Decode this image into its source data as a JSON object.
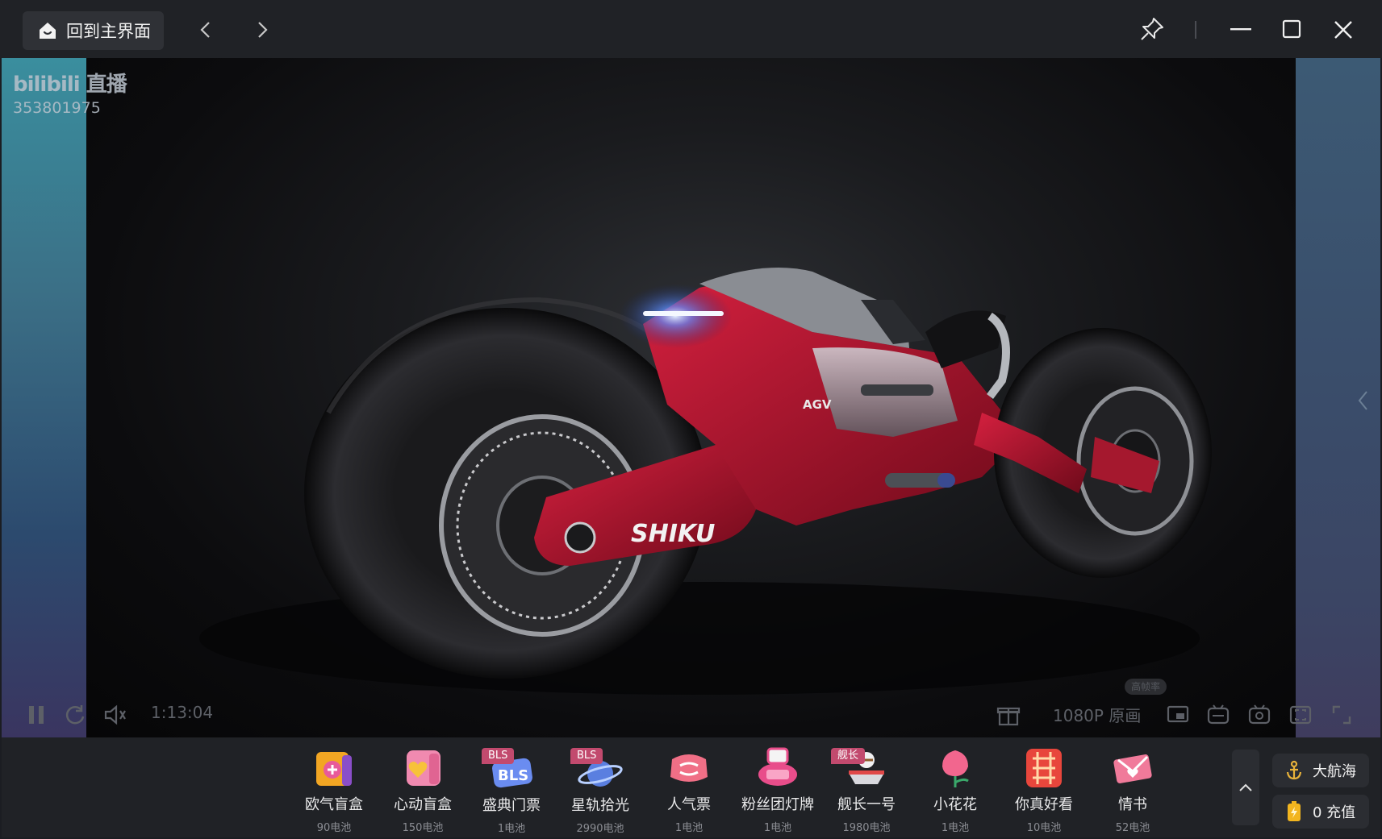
{
  "titlebar": {
    "home_label": "回到主界面",
    "icons": [
      "home-icon",
      "back-icon",
      "forward-icon",
      "pin-icon",
      "minimize-icon",
      "maximize-icon",
      "close-icon"
    ]
  },
  "video": {
    "platform_logo": "bilibili 直播",
    "room_id": "353801975",
    "elapsed": "1:13:04",
    "quality": "1080P 原画",
    "hfr_badge": "高帧率",
    "bike_brand": "SHIKU",
    "bike_badge": "AGV"
  },
  "gifts": [
    {
      "name": "欧气盲盒",
      "price": "90电池",
      "tag": "",
      "color": "#f2a623"
    },
    {
      "name": "心动盲盒",
      "price": "150电池",
      "tag": "",
      "color": "#f08ab0"
    },
    {
      "name": "盛典门票",
      "price": "1电池",
      "tag": "BLS",
      "color": "#6a8cf0"
    },
    {
      "name": "星轨拾光",
      "price": "2990电池",
      "tag": "BLS",
      "color": "#5a7fe0"
    },
    {
      "name": "人气票",
      "price": "1电池",
      "tag": "",
      "color": "#f06f86"
    },
    {
      "name": "粉丝团灯牌",
      "price": "1电池",
      "tag": "",
      "color": "#e84d8a"
    },
    {
      "name": "舰长一号",
      "price": "1980电池",
      "tag": "舰长",
      "color": "#d9d9de"
    },
    {
      "name": "小花花",
      "price": "1电池",
      "tag": "",
      "color": "#f2668e"
    },
    {
      "name": "你真好看",
      "price": "10电池",
      "tag": "",
      "color": "#e8463c"
    },
    {
      "name": "情书",
      "price": "52电池",
      "tag": "",
      "color": "#f07a9a"
    }
  ],
  "side": {
    "guard_label": "大航海",
    "recharge_label": "0 充值"
  },
  "colors": {
    "titlebar_bg": "#202226",
    "gift_tag": "#c24a6e",
    "accent_red": "#b0122e"
  }
}
